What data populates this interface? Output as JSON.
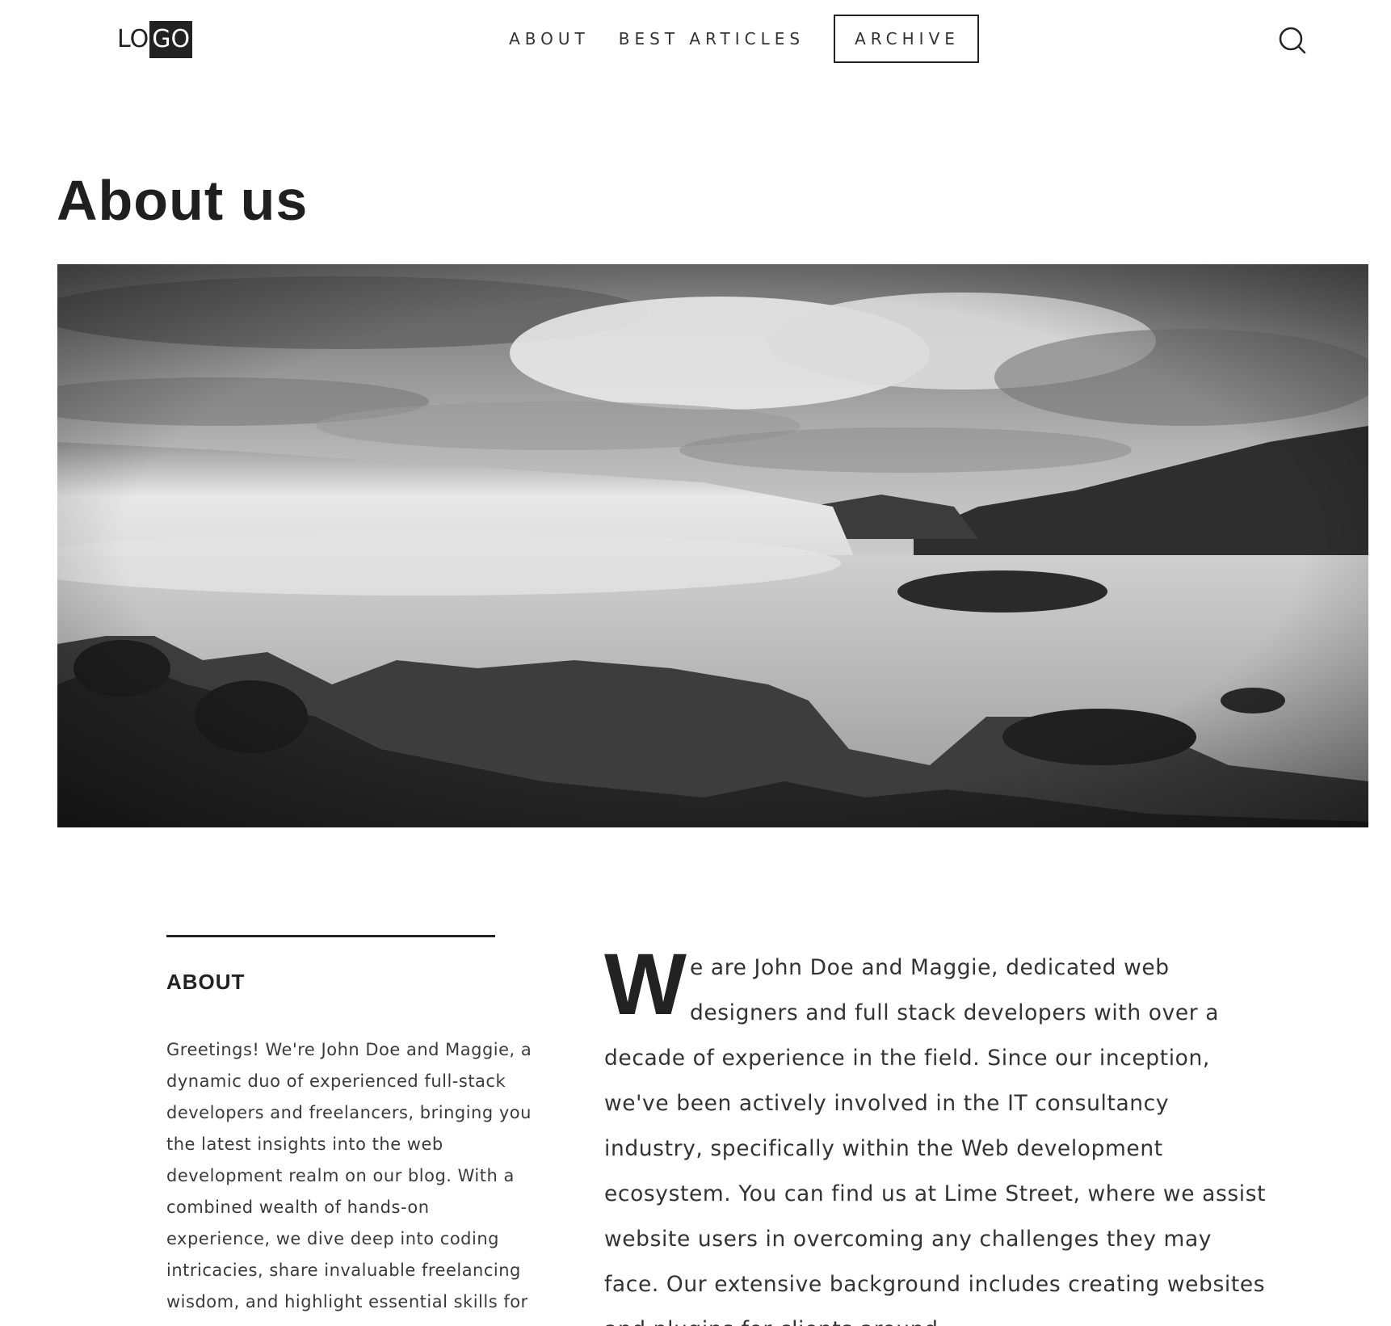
{
  "header": {
    "logo_part1": "LO",
    "logo_part2": "GO",
    "nav": {
      "about": "ABOUT",
      "best_articles": "BEST ARTICLES",
      "archive": "ARCHIVE"
    },
    "search_icon": "search-icon"
  },
  "page": {
    "title": "About us"
  },
  "hero": {
    "description_icon": "landscape-photo"
  },
  "sidebar": {
    "heading": "ABOUT",
    "text": "Greetings! We're John Doe and Maggie, a dynamic duo of experienced full-stack developers and freelancers, bringing you the latest insights into the web development realm on our blog. With a combined wealth of hands-on experience, we dive deep into coding intricacies, share invaluable freelancing wisdom, and highlight essential skills for"
  },
  "main": {
    "dropcap": "W",
    "text": "e are John Doe and Maggie, dedicated web designers and full stack developers with over a decade of experience in the field. Since our inception, we've been actively involved in the IT consultancy industry, specifically within the Web development ecosystem. You can find us at Lime Street, where we assist website users in overcoming any challenges they may face. Our extensive background includes creating websites and plugins for clients around"
  },
  "colors": {
    "text": "#222222",
    "background": "#ffffff"
  }
}
